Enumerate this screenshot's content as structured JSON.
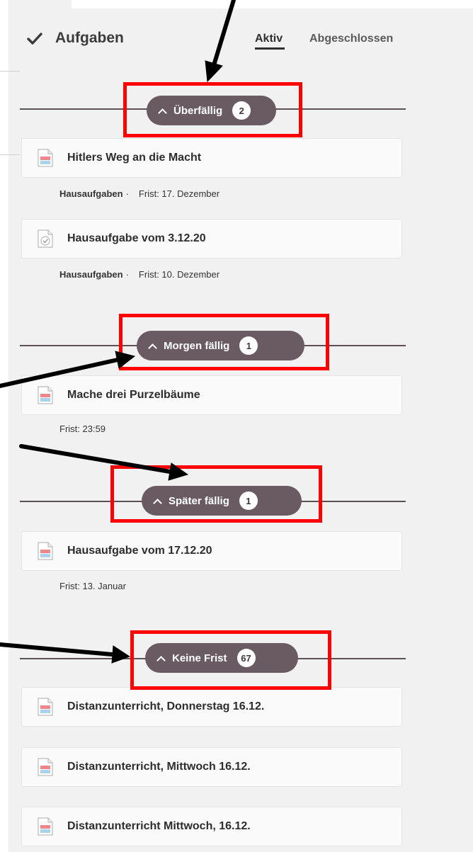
{
  "header": {
    "title": "Aufgaben",
    "tabs": [
      {
        "label": "Aktiv",
        "active": true
      },
      {
        "label": "Abgeschlossen",
        "active": false
      }
    ]
  },
  "sections": [
    {
      "label": "Überfällig",
      "count": "2",
      "items": [
        {
          "title": "Hitlers Weg an die Macht",
          "icon": "document-icon",
          "type": "Hausaufgaben",
          "sep": "·",
          "deadline": "Frist: 17. Dezember"
        },
        {
          "title": "Hausaufgabe vom 3.12.20",
          "icon": "checked-document-icon",
          "type": "Hausaufgaben",
          "sep": "·",
          "deadline": "Frist: 10. Dezember"
        }
      ]
    },
    {
      "label": "Morgen fällig",
      "count": "1",
      "items": [
        {
          "title": "Mache drei Purzelbäume",
          "icon": "document-icon",
          "deadline": "Frist: 23:59"
        }
      ]
    },
    {
      "label": "Später fällig",
      "count": "1",
      "items": [
        {
          "title": "Hausaufgabe vom 17.12.20",
          "icon": "document-icon",
          "deadline": "Frist: 13. Januar"
        }
      ]
    },
    {
      "label": "Keine Frist",
      "count": "67",
      "items": [
        {
          "title": "Distanzunterricht, Donnerstag 16.12.",
          "icon": "document-icon"
        },
        {
          "title": "Distanzunterricht, Mittwoch 16.12.",
          "icon": "document-icon"
        },
        {
          "title": "Distanzunterricht Mittwoch, 16.12.",
          "icon": "document-icon"
        }
      ]
    }
  ],
  "colors": {
    "pill": "#6a5b62",
    "line": "#5c4f55",
    "annotation_box": "#ff0000",
    "annotation_arrow": "#000000"
  }
}
